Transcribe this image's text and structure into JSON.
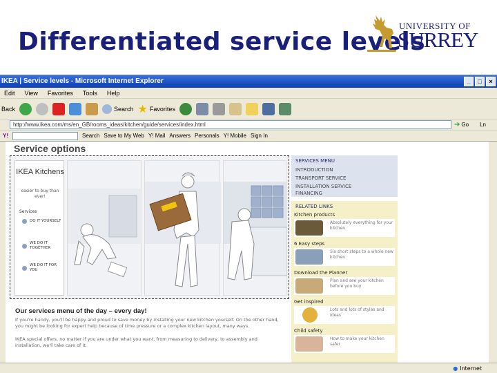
{
  "slide": {
    "title": "Differentiated service levels",
    "logo": {
      "line1": "UNIVERSITY OF",
      "line2": "SURREY"
    }
  },
  "browser": {
    "window_title": "IKEA | Service levels - Microsoft Internet Explorer",
    "menu": [
      "Edit",
      "View",
      "Favorites",
      "Tools",
      "Help"
    ],
    "toolbar": {
      "back": "Back",
      "search": "Search",
      "favorites": "Favorites"
    },
    "address": "http://www.ikea.com/ms/en_GB/rooms_ideas/kitchen/guide/services/index.html",
    "go": "Go",
    "links_prefix": "Ln",
    "links": {
      "search": "Search",
      "save": "Save to My Web",
      "mail": "Y! Mail",
      "answers": "Answers",
      "personals": "Personals",
      "mobile": "Y! Mobile",
      "signin": "Sign In"
    },
    "status": "",
    "zone": "Internet"
  },
  "page": {
    "heading": "Service options",
    "panel": {
      "title": "IKEA Kitchens",
      "tagline": "easier to buy than ever!",
      "services_label": "Services",
      "options": [
        "DO IT YOURSELF",
        "WE DO IT TOGETHER",
        "WE DO IT FOR YOU"
      ]
    },
    "menu_day_title": "Our services menu of the day – every day!",
    "para1": "If you're handy, you'll be happy and proud to save money by installing your new kitchen yourself. On the other hand, you might be looking for expert help because of time pressure or a complex kitchen layout, many ways.",
    "para2": "IKEA special offers, no matter if you are under what you want, from measuring to delivery, to assembly and installation, we'll take care of it."
  },
  "sidebar": {
    "menu_title": "SERVICES MENU",
    "menu_items": [
      "INTRODUCTION",
      "TRANSPORT SERVICE",
      "INSTALLATION SERVICE",
      "FINANCING"
    ],
    "related_title": "RELATED LINKS",
    "related": [
      {
        "title": "Kitchen products",
        "text": "Absolutely everything for your kitchen",
        "color": "#6b5a3a"
      },
      {
        "title": "6 Easy steps",
        "text": "Six short steps to a whole new kitchen",
        "color": "#8aa0b8"
      },
      {
        "title": "Download the Planner",
        "text": "Plan and see your kitchen before you buy",
        "color": "#c7a97a"
      },
      {
        "title": "Get inspired",
        "text": "Lots and lots of styles and ideas",
        "color": "#e3b23c"
      },
      {
        "title": "Child safety",
        "text": "How to make your kitchen safer",
        "color": "#d9b49a"
      }
    ]
  }
}
